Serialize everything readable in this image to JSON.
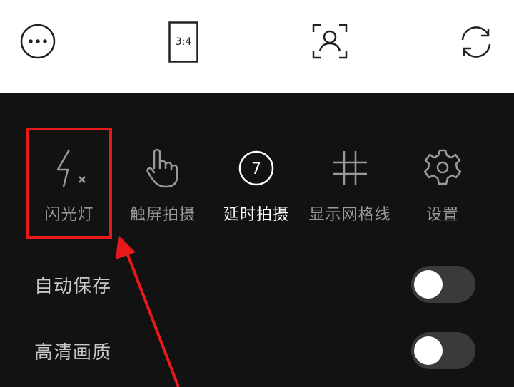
{
  "top_bar": {
    "more_icon": "more-horizontal-icon",
    "aspect_ratio_label": "3:4",
    "face_icon": "face-scan-icon",
    "switch_camera_icon": "switch-camera-icon"
  },
  "tools": [
    {
      "label": "闪光灯",
      "icon": "flash-off-icon"
    },
    {
      "label": "触屏拍摄",
      "icon": "touch-capture-icon"
    },
    {
      "label": "延时拍摄",
      "icon": "timer-icon",
      "timer_value": "7"
    },
    {
      "label": "显示网格线",
      "icon": "grid-icon"
    },
    {
      "label": "设置",
      "icon": "settings-icon"
    }
  ],
  "settings": [
    {
      "label": "自动保存",
      "enabled": false
    },
    {
      "label": "高清画质",
      "enabled": false
    }
  ],
  "colors": {
    "panel_bg": "#121212",
    "highlight_red": "#e8191b",
    "active_label": "#ffffff",
    "inactive_label": "#9a9a9a"
  }
}
